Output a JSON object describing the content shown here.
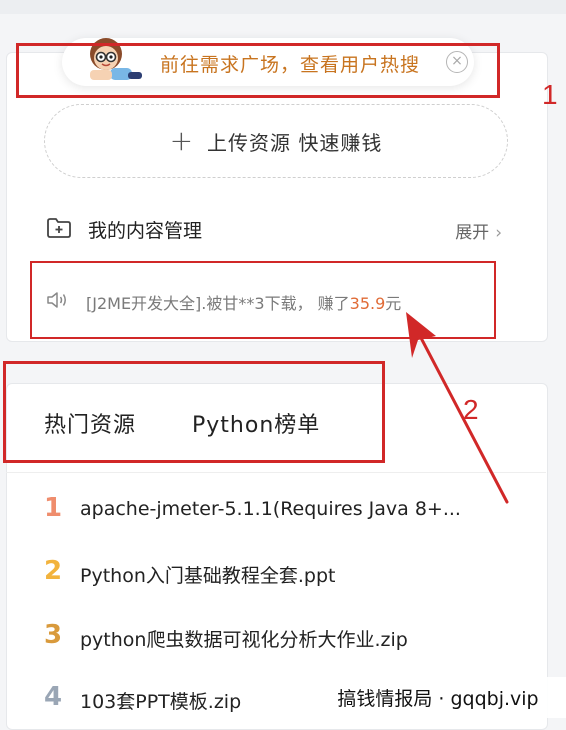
{
  "notice": {
    "text": "前往需求广场，查看用户热搜",
    "close_symbol": "×",
    "mascot_icon": "mascot-icon",
    "close_icon": "close-circle-icon"
  },
  "upload": {
    "plus_symbol": "+",
    "label": "上传资源 快速赚钱"
  },
  "content_manage": {
    "icon": "folder-plus-icon",
    "title": "我的内容管理",
    "expand_label": "展开",
    "expand_chevron": "›"
  },
  "ticker": {
    "icon": "speaker-icon",
    "prefix": "[J2ME开发大全].被甘**3下载， 赚了",
    "amount": "35.9",
    "suffix": "元",
    "amount_color": "#e06b36"
  },
  "tabs": [
    {
      "label": "热门资源"
    },
    {
      "label": "Python榜单"
    }
  ],
  "rank_list": [
    {
      "rank": "1",
      "title": "apache-jmeter-5.1.1(Requires Java 8+...",
      "color": "#ef8d6d"
    },
    {
      "rank": "2",
      "title": "Python入门基础教程全套.ppt",
      "color": "#f2b33d"
    },
    {
      "rank": "3",
      "title": "python爬虫数据可视化分析大作业.zip",
      "color": "#d99a3c"
    },
    {
      "rank": "4",
      "title": "103套PPT模板.zip",
      "color": "#9aa6b5"
    }
  ],
  "annotations": {
    "label_1": "1",
    "label_2": "2",
    "color": "#d12828"
  },
  "watermark": {
    "text": "搞钱情报局 · gqqbj.vip"
  }
}
